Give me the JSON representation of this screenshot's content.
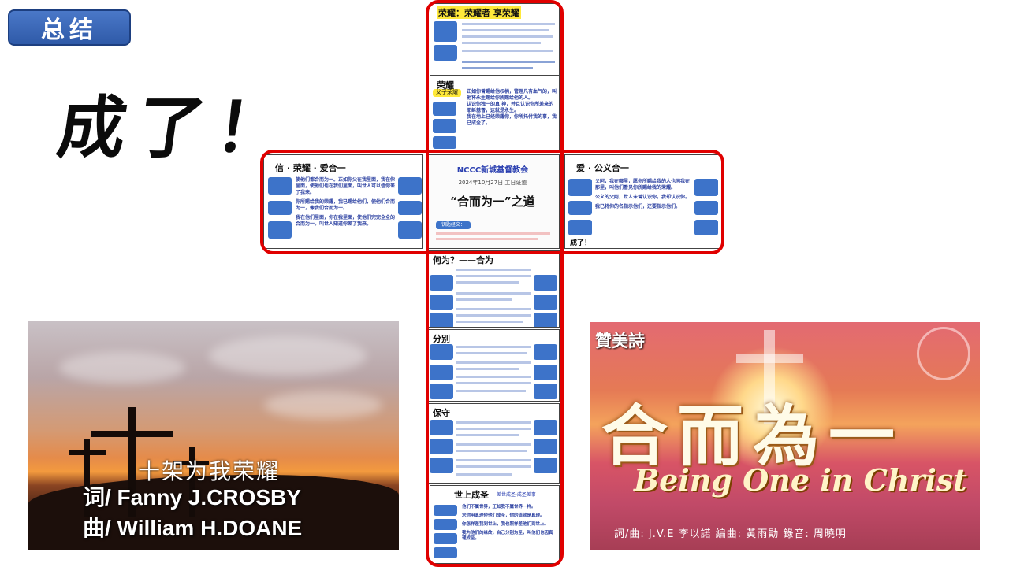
{
  "header": {
    "badge": "总结",
    "big_title": "成了！"
  },
  "left_image": {
    "song_title": "十架为我荣耀",
    "lyrics_credit": "词/ Fanny J.CROSBY",
    "music_credit": "曲/ William H.DOANE"
  },
  "right_image": {
    "tag": "贊美詩",
    "title": "合而為一",
    "subtitle": "Being One in Christ",
    "credits": "詞/曲: J.V.E 李以諾   編曲: 黃雨勛   錄音: 周曉明"
  },
  "cross": {
    "top_panel": {
      "heading": "荣耀：荣耀者 享荣耀"
    },
    "glory_panel": {
      "heading": "荣耀",
      "tag": "父子荣耀",
      "lines": [
        "正如你曾赐给他权柄，管理凡有血气的，叫他将永生赐给你所赐给他的人。",
        "认识你独一的真 神，并且认识你所差来的耶稣基督，这就是永生。",
        "我在地上已经荣耀你，你所托付我的事，我已成全了。"
      ]
    },
    "left_panel": {
      "heading": "信 · 荣耀 · 爱合一",
      "lines": [
        "使他们都合而为一。正如你父在我里面，我在你里面，使他们也在我们里面，叫世人可以信你差了我来。",
        "你所赐给我的荣耀，我已赐给他们，使他们合而为一，像我们合而为一。",
        "我在他们里面，你在我里面，使他们完完全全的合而为一。叫世人知道你差了我来。"
      ]
    },
    "center_panel": {
      "church": "NCCC新城基督教会",
      "date": "2024年10月27日 主日证道",
      "sermon": "“合而为一”之道",
      "scripture_label": "钥匙经文："
    },
    "right_panel": {
      "heading": "爱 · 公义合一",
      "lines": [
        "父阿，我在哪里，愿你所赐给我的人也同我在那里，叫他们看见你所赐给我的荣耀。",
        "公义的父阿，世人未曾认识你，我却认识你。",
        "我已将你的名指示他们，还要指示他们。"
      ],
      "footer": "成了！"
    },
    "why_panel": {
      "heading": "何为？——合为"
    },
    "sep_panel": {
      "heading": "分别"
    },
    "keep_panel": {
      "heading": "保守"
    },
    "bottom_panel": {
      "heading": "世上成圣",
      "subheading": "—差世成圣·成圣差事",
      "lines": [
        "他们不属世界，正如我不属世界一样。",
        "求你用真理使他们成圣，你的道就是真理。",
        "你怎样差我到世上，我也照样差他们到世上。",
        "我为他们的缘故，自己分别为圣，叫他们也因真理成圣。"
      ]
    }
  }
}
